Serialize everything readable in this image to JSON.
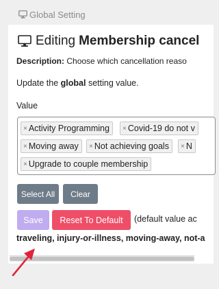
{
  "breadcrumb": {
    "icon": "monitor-icon",
    "label": "Global Setting"
  },
  "header": {
    "icon": "monitor-icon",
    "title_prefix": "Editing",
    "title_bold": "Membership cancel"
  },
  "description": {
    "label": "Description:",
    "text": "Choose which cancellation reaso"
  },
  "instruction": {
    "before": "Update the",
    "bold": "global",
    "after": "setting value."
  },
  "field": {
    "label": "Value",
    "tags": [
      "Activity Programming",
      "Covid-19 do not v",
      "Moving away",
      "Not achieving goals",
      "N",
      "Upgrade to couple membership"
    ],
    "remove_glyph": "×"
  },
  "buttons": {
    "select_all": "Select All",
    "clear": "Clear",
    "save": "Save",
    "reset": "Reset To Default"
  },
  "default_value": {
    "label": "(default value ac",
    "values": "traveling, injury-or-illness, moving-away, not-a"
  },
  "colors": {
    "secondary_button": "#6e7b88",
    "save_button_disabled": "#c0acf0",
    "reset_button": "#ef4e68",
    "annotation_arrow": "#e0243c"
  }
}
